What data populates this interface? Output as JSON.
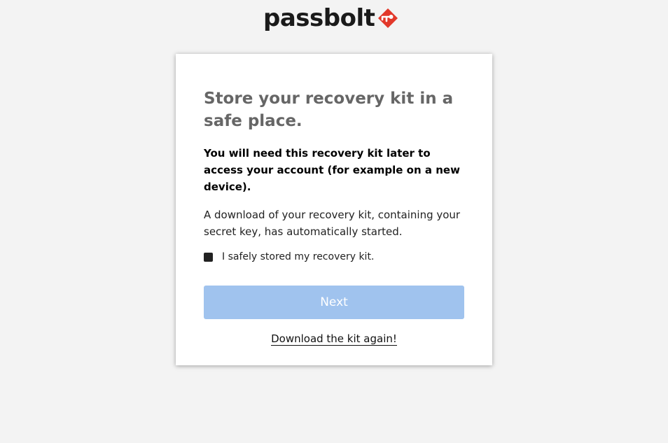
{
  "header": {
    "brand": "passbolt"
  },
  "colors": {
    "brand_red": "#e2382a",
    "button_disabled": "#a0c3ee",
    "background": "#f3f3f3"
  },
  "card": {
    "title": "Store your recovery kit in a safe place.",
    "bold_text": "You will need this recovery kit later to access your account (for example on a new device).",
    "info_text": "A download of your recovery kit, containing your secret key, has automatically started.",
    "checkbox_label": "I safely stored my recovery kit.",
    "checkbox_checked": false,
    "next_label": "Next",
    "download_label": "Download the kit again!"
  }
}
